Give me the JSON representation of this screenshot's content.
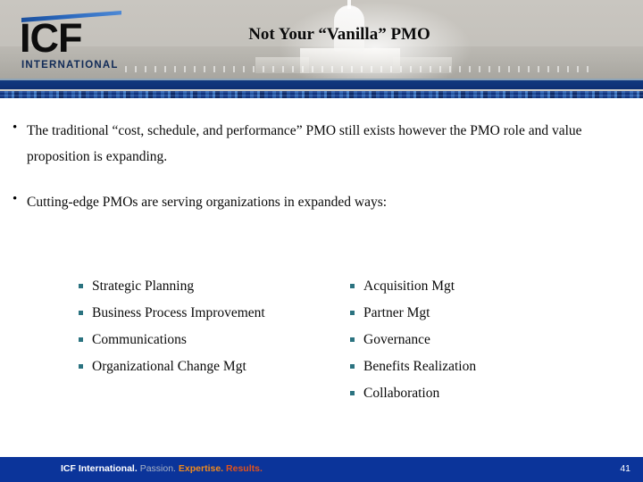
{
  "slide": {
    "title": "Not Your “Vanilla” PMO",
    "page_number": "41"
  },
  "logo": {
    "mark": "ICF",
    "subtitle": "INTERNATIONAL",
    "swoosh_color": "#2a68bd",
    "mark_color": "#0d0d0d",
    "subtitle_color": "#102a57"
  },
  "body": {
    "bullets": [
      {
        "marker": "•",
        "text": "The traditional “cost, schedule, and performance” PMO still exists however the PMO role and value proposition is expanding."
      },
      {
        "marker": "•",
        "text": "Cutting-edge PMOs are serving organizations in expanded ways:"
      }
    ],
    "sub_bullet_color": "#2b7380",
    "columns": {
      "left": [
        "Strategic Planning",
        "Business Process Improvement",
        "Communications",
        "Organizational Change Mgt"
      ],
      "right": [
        "Acquisition Mgt",
        "Partner Mgt",
        "Governance",
        "Benefits Realization",
        "Collaboration"
      ]
    }
  },
  "footer": {
    "company": "ICF International.",
    "word_passion": "Passion.",
    "word_expertise": "Expertise.",
    "word_results": "Results.",
    "bar_color": "#0b349a",
    "expertise_color": "#f08a1c",
    "results_color": "#e2521b",
    "page_number": "41"
  },
  "decor": {
    "divider_blue": "#10347a",
    "header_bg": "#c6c3bd"
  }
}
